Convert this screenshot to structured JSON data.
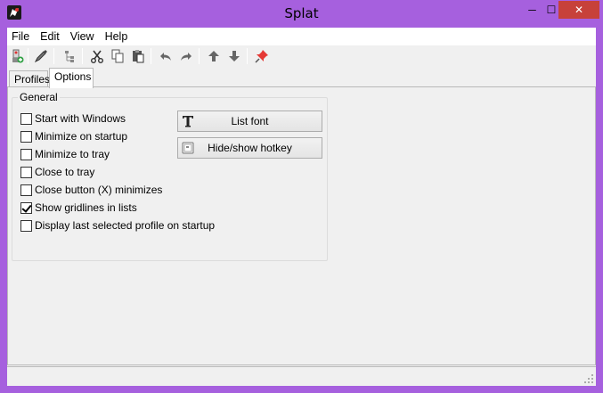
{
  "window": {
    "title": "Splat",
    "accent": "#a660de",
    "close_color": "#c7413a"
  },
  "titlebar_buttons": {
    "minimize_glyph": "─",
    "maximize_glyph": "☐",
    "close_glyph": "✕"
  },
  "menu": {
    "items": [
      "File",
      "Edit",
      "View",
      "Help"
    ]
  },
  "toolbar": {
    "icons": [
      "new-profile-icon",
      "edit-icon",
      "tree-icon",
      "cut-icon",
      "copy-icon",
      "paste-icon",
      "undo-icon",
      "redo-icon",
      "move-up-icon",
      "move-down-icon",
      "pin-icon"
    ]
  },
  "tabs": {
    "profiles": "Profiles",
    "options": "Options"
  },
  "general": {
    "legend": "General",
    "options": [
      {
        "label": "Start with Windows",
        "checked": false
      },
      {
        "label": "Minimize on startup",
        "checked": false
      },
      {
        "label": "Minimize to tray",
        "checked": false
      },
      {
        "label": "Close to tray",
        "checked": false
      },
      {
        "label": "Close button (X) minimizes",
        "checked": false
      },
      {
        "label": "Show gridlines in lists",
        "checked": true
      },
      {
        "label": "Display last selected profile on startup",
        "checked": false
      }
    ],
    "list_font_button": "List font",
    "hotkey_button": "Hide/show hotkey"
  }
}
